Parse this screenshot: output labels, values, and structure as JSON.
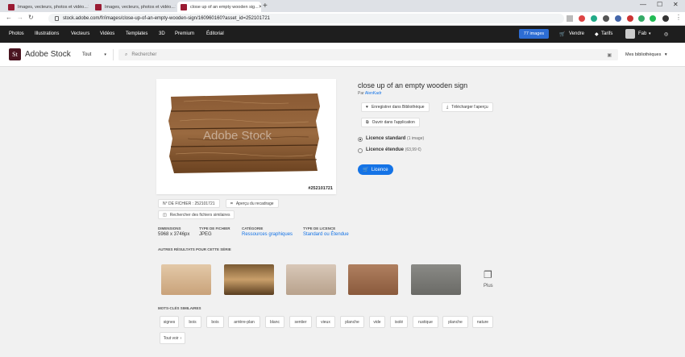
{
  "browser": {
    "tabs": [
      {
        "title": "Images, vecteurs, photos et vidéo...",
        "active": false
      },
      {
        "title": "Images, vecteurs, photos et vidéo...",
        "active": false
      },
      {
        "title": "close up of an empty wooden sig...",
        "active": true
      }
    ],
    "url": "stock.adobe.com/fr/images/close-up-of-an-empty-wooden-sign/160960160?asset_id=252101721"
  },
  "stock_nav": {
    "items": [
      "Photos",
      "Illustrations",
      "Vecteurs",
      "Vidéos",
      "Templates",
      "3D",
      "Premium",
      "Éditorial"
    ],
    "images_badge": "77 images",
    "vendre": "Vendre",
    "tarifs": "Tarifs",
    "user": "Fab"
  },
  "search": {
    "logo_mark": "St",
    "logo_text": "Adobe Stock",
    "type": "Tout",
    "placeholder": "Rechercher",
    "libraries": "Mes bibliothèques"
  },
  "asset": {
    "title": "close up of an empty wooden sign",
    "by_prefix": "Par",
    "author": "AlenKadr",
    "id_label": "#252101721",
    "file_no": "N° DE FICHIER : 252101721",
    "crop_preview": "Aperçu du recadrage",
    "find_similar": "Rechercher des fichiers similaires",
    "watermark": "Adobe Stock"
  },
  "actions": {
    "save_library": "Enregistrer dans Bibliothèque",
    "download_preview": "Télécharger l'aperçu",
    "open_app": "Ouvrir dans l'application"
  },
  "license": {
    "standard": "Licence standard",
    "standard_sub": "(1 image)",
    "extended": "Licence étendue",
    "extended_sub": "(63,99 €)",
    "button": "Licence"
  },
  "info": {
    "dimensions_label": "DIMENSIONS",
    "dimensions": "5968 x 3746px",
    "filetype_label": "TYPE DE FICHIER",
    "filetype": "JPEG",
    "category_label": "CATÉGORIE",
    "category": "Ressources graphiques",
    "licensetype_label": "TYPE DE LICENCE",
    "licensetype": "Standard ou Étendue"
  },
  "series": {
    "heading": "AUTRES RÉSULTATS POUR CETTE SÉRIE",
    "more": "Plus"
  },
  "keywords": {
    "heading": "MOTS-CLÉS SIMILAIRES",
    "tags": [
      "signes",
      "bois",
      "bois",
      "arrière-plan",
      "blanc",
      "sentier",
      "vieux",
      "planche",
      "vide",
      "isolé",
      "rustique",
      "planche",
      "nature"
    ],
    "see_all": "Tout voir"
  },
  "colors": {
    "accent": "#1473e6",
    "nav_bg": "#1e1e1e",
    "logo_bg": "#4a1420"
  }
}
